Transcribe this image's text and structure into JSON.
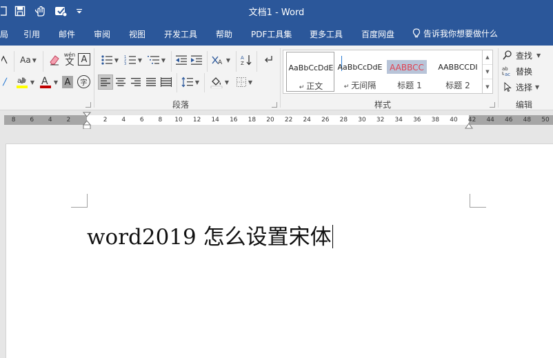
{
  "window": {
    "title": "文档1 - Word"
  },
  "tabs": [
    "局",
    "引用",
    "邮件",
    "审阅",
    "视图",
    "开发工具",
    "帮助",
    "PDF工具集",
    "更多工具",
    "百度网盘"
  ],
  "tell_me": "告诉我你想要做什么",
  "ribbon": {
    "font": {
      "change_case": "Aa",
      "phonetic": "wén",
      "phonetic_char": "文",
      "border_char": "A",
      "shade_char": "A",
      "enclosed_char": "字",
      "highlight_color": "#ffff00",
      "font_color": "#c00000"
    },
    "paragraph": {
      "label": "段落"
    },
    "styles": {
      "label": "样式",
      "items": [
        {
          "preview": "AaBbCcDdE",
          "name": "正文",
          "selected": true
        },
        {
          "preview": "AaBbCcDdE",
          "name": "无间隔",
          "selected": false
        },
        {
          "preview": "AABBCC",
          "name": "标题 1",
          "selected": false
        },
        {
          "preview": "AABBCCDI",
          "name": "标题 2",
          "selected": false
        }
      ]
    },
    "editing": {
      "label": "编辑",
      "find": "查找",
      "replace": "替换",
      "select": "选择"
    }
  },
  "ruler": {
    "left_numbers": [
      "8",
      "6",
      "4",
      "2"
    ],
    "right_numbers": [
      "2",
      "4",
      "6",
      "8",
      "10",
      "12",
      "14",
      "16",
      "18",
      "20",
      "22",
      "24",
      "26",
      "28",
      "30",
      "32",
      "34",
      "36",
      "38",
      "40",
      "42",
      "44",
      "46",
      "48",
      "50"
    ]
  },
  "document": {
    "text": "word2019 怎么设置宋体"
  }
}
